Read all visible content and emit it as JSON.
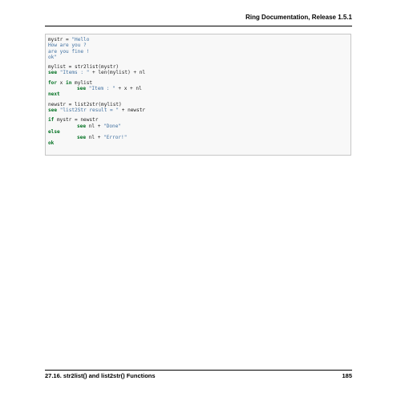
{
  "header": {
    "title": "Ring Documentation, Release 1.5.1"
  },
  "code": {
    "l1_a": "mystr = ",
    "l1_b": "\"Hello",
    "l2": "How are you ?",
    "l3": "are you fine !",
    "l4": "ok\"",
    "l5": "mylist = str2list(mystr)",
    "l6_kw": "see",
    "l6_str": "\"Items : \"",
    "l6_rest": " + len(mylist) + nl",
    "l7_kw1": "for",
    "l7_mid": " x ",
    "l7_kw2": "in",
    "l7_rest": " mylist",
    "l8_kw": "see",
    "l8_str": "\"Item : \"",
    "l8_rest": " + x + nl",
    "l9_kw": "next",
    "l10": "newstr = list2str(mylist)",
    "l11_kw": "see",
    "l11_str": "\"list2Str result = \"",
    "l11_rest": " + newstr",
    "l12_kw": "if",
    "l12_rest": " mystr = newstr",
    "l13_kw": "see",
    "l13_mid": " nl + ",
    "l13_str": "\"Done\"",
    "l14_kw": "else",
    "l15_kw": "see",
    "l15_mid": " nl + ",
    "l15_str": "\"Error!\"",
    "l16_kw": "ok"
  },
  "footer": {
    "section": "27.16.  str2list() and list2str() Functions",
    "page_number": "185"
  }
}
